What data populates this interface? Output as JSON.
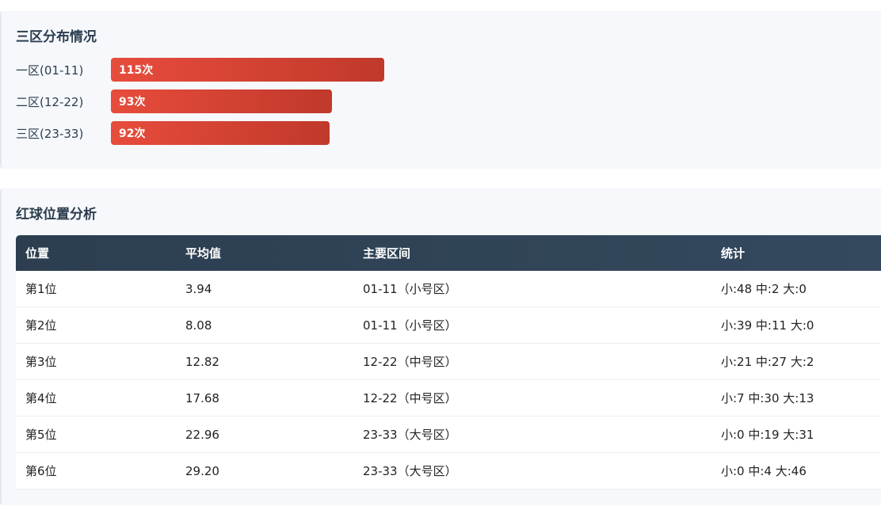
{
  "zone_section": {
    "title": "三区分布情况",
    "zones": [
      {
        "label": "一区(01-11)",
        "count_label": "115次",
        "count": 115
      },
      {
        "label": "二区(12-22)",
        "count_label": "93次",
        "count": 93
      },
      {
        "label": "三区(23-33)",
        "count_label": "92次",
        "count": 92
      }
    ],
    "max_count": 115,
    "bar_color": "#e74c3c"
  },
  "position_section": {
    "title": "红球位置分析",
    "headers": [
      "位置",
      "平均值",
      "主要区间",
      "统计"
    ],
    "rows": [
      {
        "position": "第1位",
        "average": "3.94",
        "range": "01-11（小号区）",
        "stats": "小:48 中:2 大:0"
      },
      {
        "position": "第2位",
        "average": "8.08",
        "range": "01-11（小号区）",
        "stats": "小:39 中:11 大:0"
      },
      {
        "position": "第3位",
        "average": "12.82",
        "range": "12-22（中号区）",
        "stats": "小:21 中:27 大:2"
      },
      {
        "position": "第4位",
        "average": "17.68",
        "range": "12-22（中号区）",
        "stats": "小:7 中:30 大:13"
      },
      {
        "position": "第5位",
        "average": "22.96",
        "range": "23-33（大号区）",
        "stats": "小:0 中:19 大:31"
      },
      {
        "position": "第6位",
        "average": "29.20",
        "range": "23-33（大号区）",
        "stats": "小:0 中:4 大:46"
      }
    ],
    "header_color": "#2c3e50"
  }
}
